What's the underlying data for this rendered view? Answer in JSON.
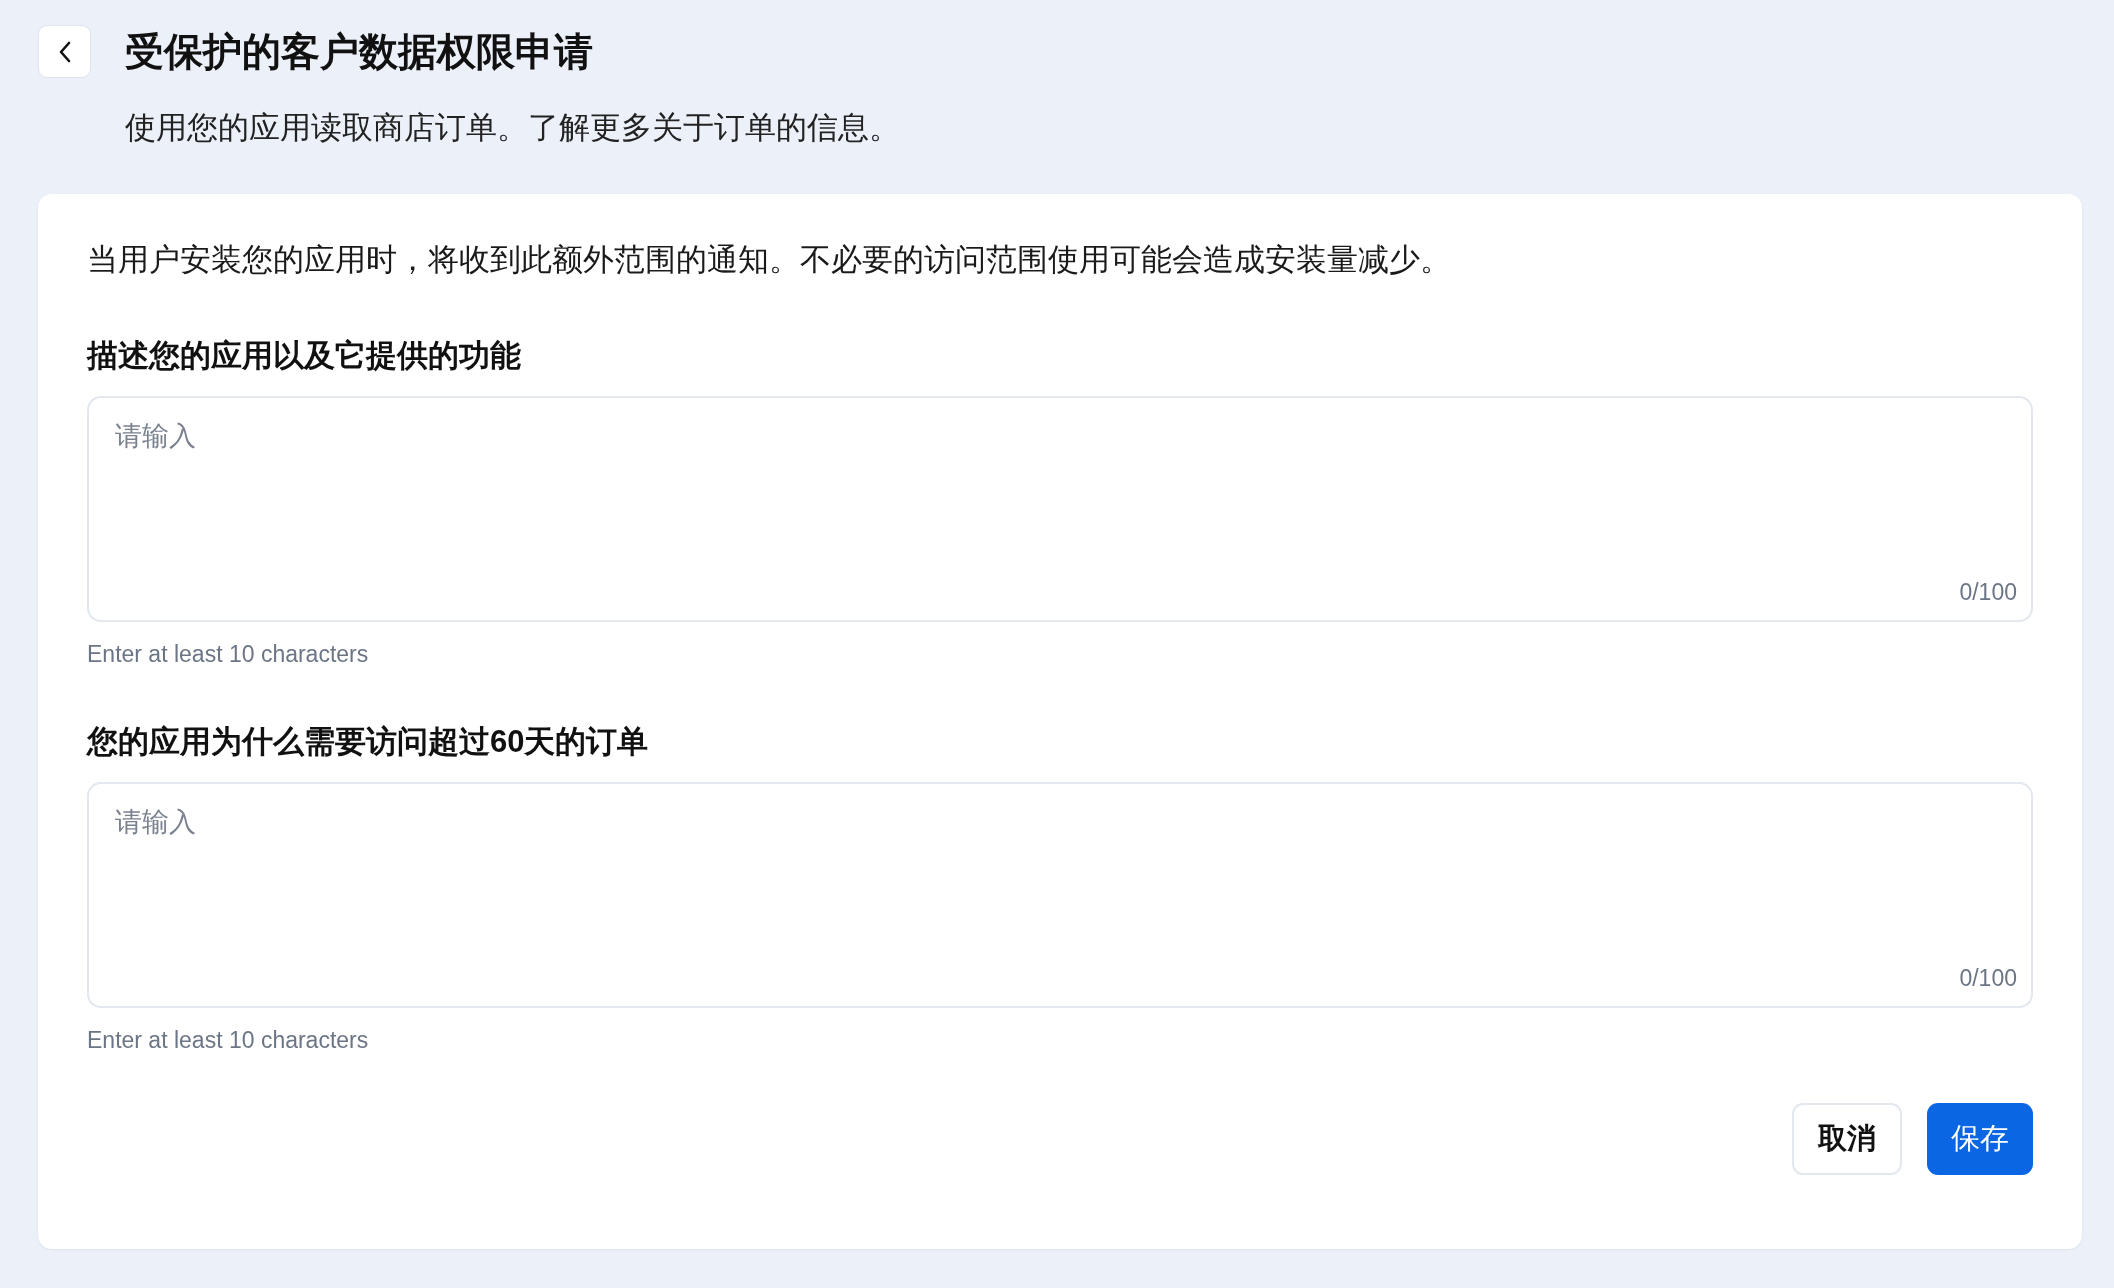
{
  "header": {
    "title": "受保护的客户数据权限申请",
    "subtitle": "使用您的应用读取商店订单。了解更多关于订单的信息。"
  },
  "notice": "当用户安装您的应用时，将收到此额外范围的通知。不必要的访问范围使用可能会造成安装量减少。",
  "fields": [
    {
      "label": "描述您的应用以及它提供的功能",
      "placeholder": "请输入",
      "counter": "0/100",
      "hint": "Enter at least 10 characters"
    },
    {
      "label": "您的应用为什么需要访问超过60天的订单",
      "placeholder": "请输入",
      "counter": "0/100",
      "hint": "Enter at least 10 characters"
    }
  ],
  "buttons": [
    {
      "label": "取消",
      "kind": "secondary"
    },
    {
      "label": "保存",
      "kind": "primary"
    }
  ]
}
